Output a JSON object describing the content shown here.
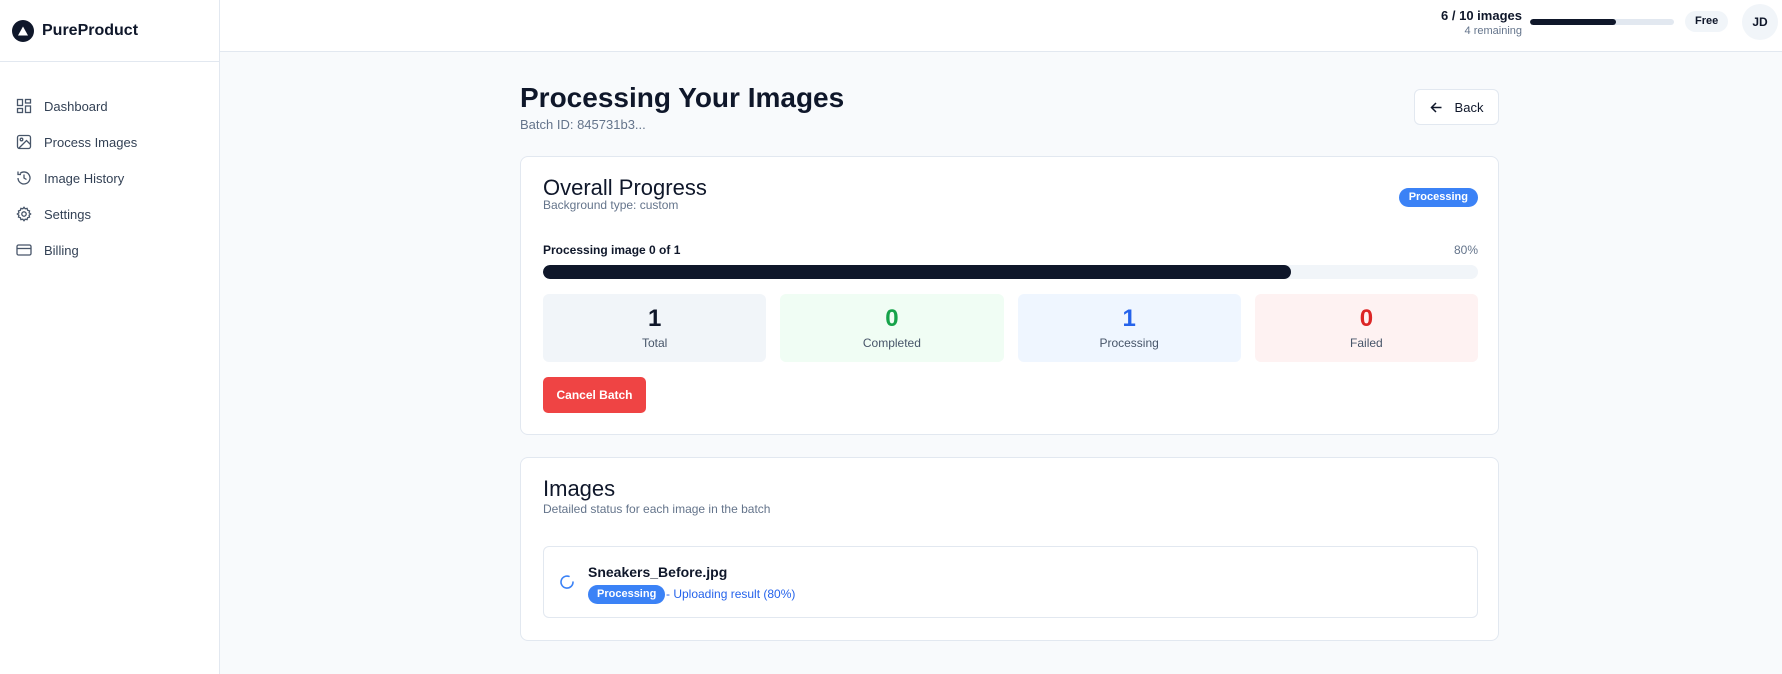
{
  "app": {
    "name": "PureProduct"
  },
  "sidebar": {
    "items": [
      {
        "label": "Dashboard",
        "icon": "dashboard-icon"
      },
      {
        "label": "Process Images",
        "icon": "image-icon"
      },
      {
        "label": "Image History",
        "icon": "history-icon"
      },
      {
        "label": "Settings",
        "icon": "gear-icon"
      },
      {
        "label": "Billing",
        "icon": "credit-card-icon"
      }
    ]
  },
  "topbar": {
    "usage_count": "6 / 10 images",
    "usage_remaining": "4 remaining",
    "usage_fraction": 0.6,
    "plan": "Free",
    "avatar_initials": "JD"
  },
  "page": {
    "title": "Processing Your Images",
    "batch_id": "Batch ID: 845731b3...",
    "back_label": "Back"
  },
  "progress": {
    "title": "Overall Progress",
    "subtitle": "Background type: custom",
    "status": "Processing",
    "label": "Processing image 0 of 1",
    "percent_text": "80%",
    "percent": 80,
    "stats": {
      "total": {
        "value": "1",
        "label": "Total"
      },
      "completed": {
        "value": "0",
        "label": "Completed"
      },
      "processing": {
        "value": "1",
        "label": "Processing"
      },
      "failed": {
        "value": "0",
        "label": "Failed"
      }
    },
    "cancel_label": "Cancel Batch"
  },
  "images": {
    "title": "Images",
    "subtitle": "Detailed status for each image in the batch",
    "items": [
      {
        "file": "Sneakers_Before.jpg",
        "status": "Processing",
        "detail": "- Uploading result (80%)"
      }
    ]
  },
  "colors": {
    "primary": "#0f172a",
    "accent_blue": "#3b82f6",
    "danger": "#ef4444",
    "success": "#16a34a"
  }
}
